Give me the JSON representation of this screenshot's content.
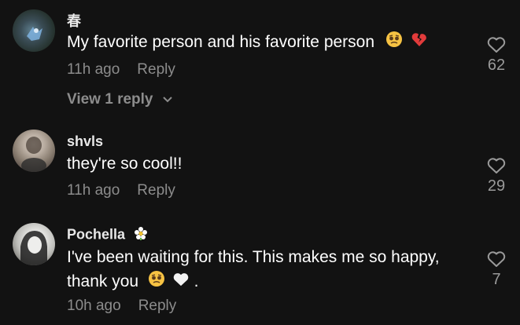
{
  "comments": [
    {
      "username": "春",
      "text": "My favorite person and his favorite person",
      "time": "11h ago",
      "reply_label": "Reply",
      "likes": "62",
      "view_replies": "View 1 reply"
    },
    {
      "username": "shvls",
      "text": "they're so cool!!",
      "time": "11h ago",
      "reply_label": "Reply",
      "likes": "29"
    },
    {
      "username": "Pochella",
      "text_line1": "I've been waiting for this. This makes me so happy,",
      "text_line2": "thank you",
      "text_tail": ".",
      "time": "10h ago",
      "reply_label": "Reply",
      "likes": "7"
    }
  ],
  "icons": [
    "heart-outline-icon",
    "chevron-down-icon",
    "pleading-face-emoji",
    "broken-heart-emoji",
    "white-heart-emoji",
    "flower-emoji"
  ]
}
